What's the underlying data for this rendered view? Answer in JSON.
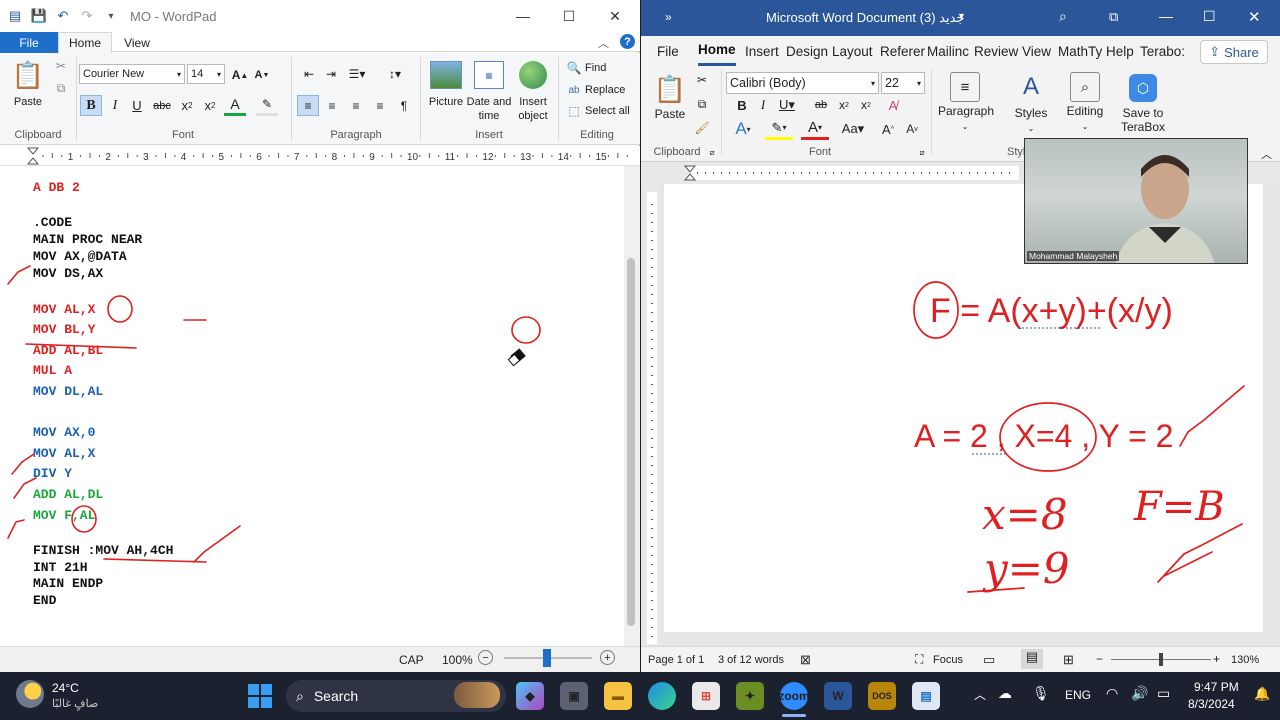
{
  "wordpad": {
    "title": "MO - WordPad",
    "tabs": {
      "file": "File",
      "home": "Home",
      "view": "View"
    },
    "clipboard": {
      "paste": "Paste",
      "label": "Clipboard"
    },
    "font": {
      "family": "Courier New",
      "size": "14",
      "label": "Font"
    },
    "paragraph": {
      "label": "Paragraph"
    },
    "insert": {
      "picture": "Picture",
      "datetime": "Date and time",
      "object": "Insert object",
      "label": "Insert"
    },
    "editing": {
      "find": "Find",
      "replace": "Replace",
      "select_all": "Select all",
      "label": "Editing"
    },
    "ruler_numbers": [
      "1",
      "2",
      "3",
      "4",
      "5",
      "6",
      "7",
      "8",
      "9",
      "10",
      "11",
      "12",
      "13",
      "14",
      "15"
    ],
    "code_lines": [
      {
        "text": "A DB 2",
        "color": "red"
      },
      {
        "text": ".CODE",
        "color": "blk"
      },
      {
        "text": "MAIN PROC NEAR",
        "color": "blk"
      },
      {
        "text": "MOV AX,@DATA",
        "color": "blk"
      },
      {
        "text": "MOV DS,AX",
        "color": "blk"
      },
      {
        "text": "MOV AL,X",
        "color": "red"
      },
      {
        "text": "MOV BL,Y",
        "color": "red"
      },
      {
        "text": "ADD AL,BL",
        "color": "red"
      },
      {
        "text": "MUL A",
        "color": "red"
      },
      {
        "text": "MOV DL,AL",
        "color": "blue"
      },
      {
        "text": "MOV AX,0",
        "color": "blue"
      },
      {
        "text": "MOV AL,X",
        "color": "blue"
      },
      {
        "text": "DIV Y",
        "color": "blue"
      },
      {
        "text": "ADD AL,DL",
        "color": "green"
      },
      {
        "text": "MOV F,AL",
        "color": "green"
      },
      {
        "text": "FINISH :MOV AH,4CH",
        "color": "blk"
      },
      {
        "text": "INT 21H",
        "color": "blk"
      },
      {
        "text": "MAIN ENDP",
        "color": "blk"
      },
      {
        "text": "END",
        "color": "blk"
      }
    ],
    "status": {
      "caps": "CAP",
      "zoom": "100%"
    }
  },
  "word": {
    "title": "Microsoft Word Document (3) جديد",
    "tabs": [
      "File",
      "Home",
      "Insert",
      "Design",
      "Layout",
      "Referer",
      "Mailinc",
      "Review",
      "View",
      "MathTy",
      "Help",
      "Terabo:"
    ],
    "share": "Share",
    "clipboard": {
      "paste": "Paste",
      "label": "Clipboard"
    },
    "font": {
      "family": "Calibri (Body)",
      "size": "22",
      "label": "Font"
    },
    "paragraph": "Paragraph",
    "styles": "Styles",
    "editing": "Editing",
    "terabox": "Save to TeraBox",
    "styles_group": "Styl",
    "doc": {
      "formula": "F = A(x+y)+(x/y)",
      "values": "A = 2 , X=4 , Y = 2",
      "hand_x": "x=8",
      "hand_y": "y=9",
      "hand_f": "F=B"
    },
    "status": {
      "page": "Page 1 of 1",
      "words": "3 of 12 words",
      "focus": "Focus",
      "zoom": "130%"
    },
    "camera_name": "Mohammad Malaysheh"
  },
  "taskbar": {
    "weather_temp": "24°C",
    "weather_desc": "صافٍ غالبًا",
    "search": "Search",
    "lang": "ENG",
    "time": "9:47 PM",
    "date": "8/3/2024"
  },
  "colors": {
    "wordpad_accent": "#1e6fc9",
    "word_accent": "#2b579a",
    "ink_red": "#e02020",
    "code_blue": "#1a5fb4",
    "code_green": "#18a83a"
  }
}
